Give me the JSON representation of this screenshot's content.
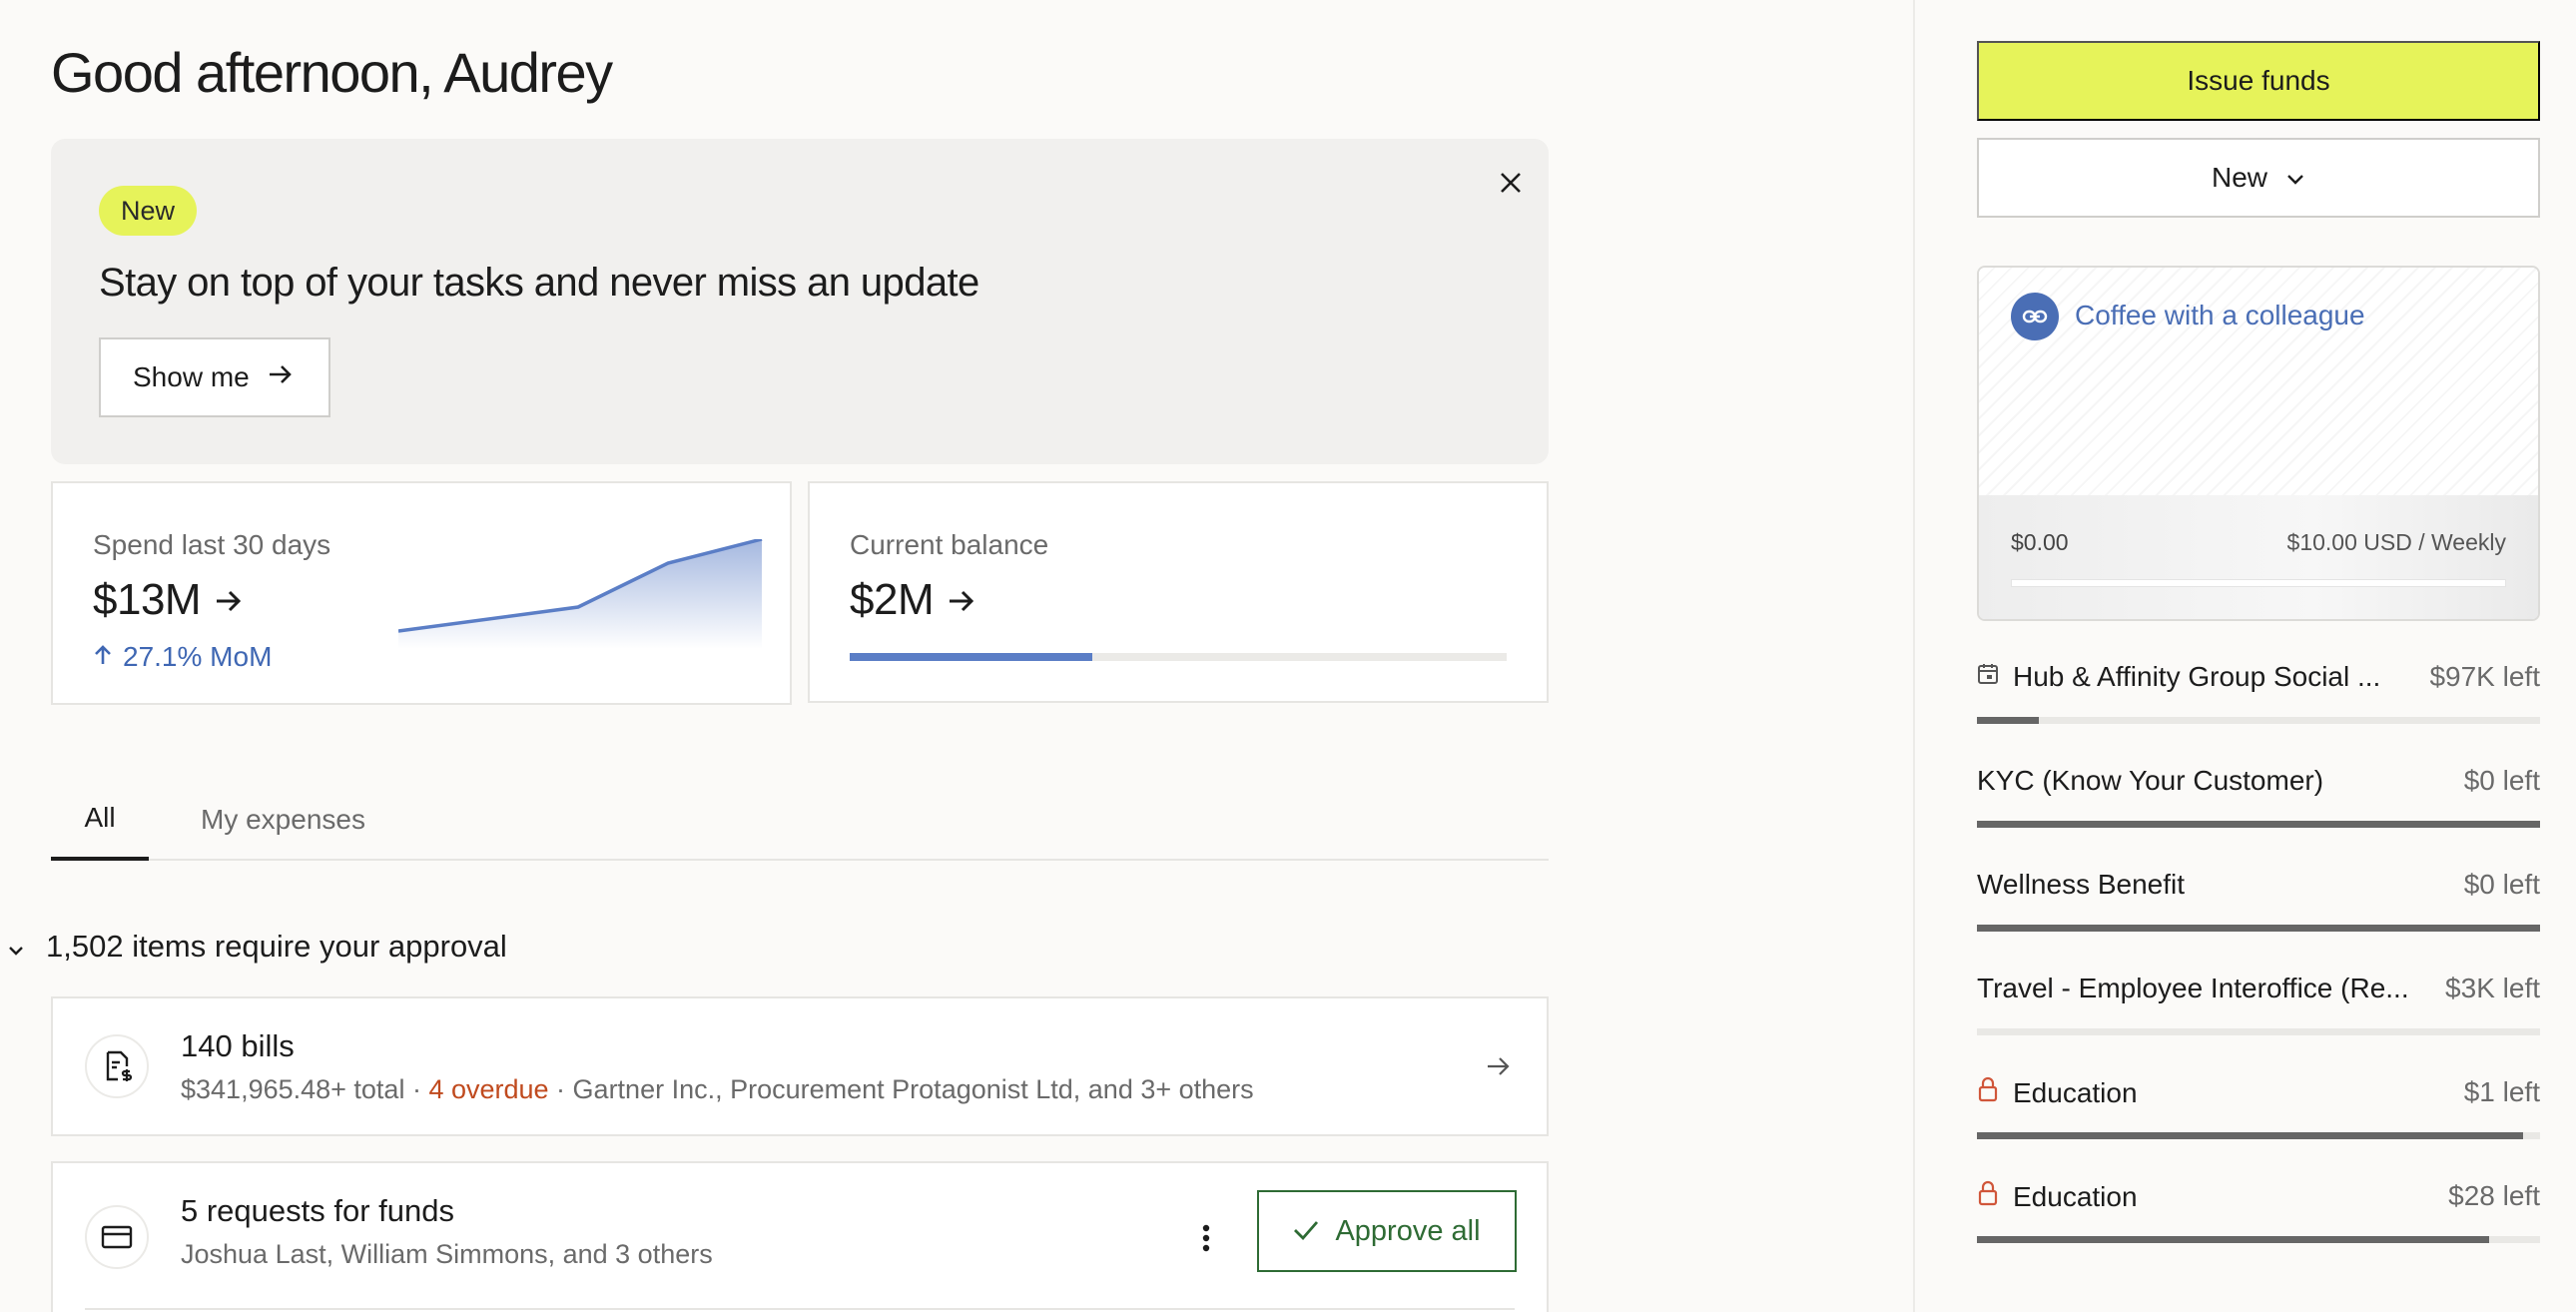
{
  "greeting": "Good afternoon, Audrey",
  "banner": {
    "badge": "New",
    "title": "Stay on top of your tasks and never miss an update",
    "cta": "Show me"
  },
  "metrics": {
    "spend": {
      "label": "Spend last 30 days",
      "value": "$13M",
      "mom": "27.1% MoM"
    },
    "balance": {
      "label": "Current balance",
      "value": "$2M",
      "progress": 0.37
    }
  },
  "tabs": [
    {
      "label": "All",
      "active": true
    },
    {
      "label": "My expenses",
      "active": false
    }
  ],
  "approvals": {
    "heading": "1,502 items require your approval",
    "bills": {
      "title": "140 bills",
      "total": "$341,965.48+ total",
      "sep": " · ",
      "overdue": "4 overdue",
      "vendors": "Gartner Inc., Procurement Protagonist Ltd, and 3+ others"
    },
    "funds": {
      "title": "5 requests for funds",
      "people": "Joshua Last, William Simmons, and 3 others",
      "approve_label": "Approve all"
    }
  },
  "side": {
    "issue_label": "Issue funds",
    "new_label": "New",
    "featured_budget": {
      "name": "Coffee with a colleague",
      "spent": "$0.00",
      "limit": "$10.00 USD / Weekly",
      "progress": 0
    },
    "budgets": [
      {
        "name": "Hub & Affinity Group Social ...",
        "left": "$97K left",
        "icon": "calendar-icon",
        "progress": 0.11
      },
      {
        "name": "KYC (Know Your Customer)",
        "left": "$0 left",
        "icon": "",
        "progress": 1.0
      },
      {
        "name": "Wellness Benefit",
        "left": "$0 left",
        "icon": "",
        "progress": 1.0
      },
      {
        "name": "Travel - Employee Interoffice (Re...",
        "left": "$3K left",
        "icon": "",
        "progress": 0
      },
      {
        "name": "Education",
        "left": "$1 left",
        "icon": "lock-icon",
        "progress": 0.97
      },
      {
        "name": "Education",
        "left": "$28 left",
        "icon": "lock-icon",
        "progress": 0.91
      }
    ]
  },
  "colors": {
    "accent_yellow": "#e6f35a",
    "link_blue": "#4a6eb5",
    "approve_green": "#2e6b34",
    "overdue_red": "#c04a1e",
    "lock_red": "#d0563a"
  }
}
